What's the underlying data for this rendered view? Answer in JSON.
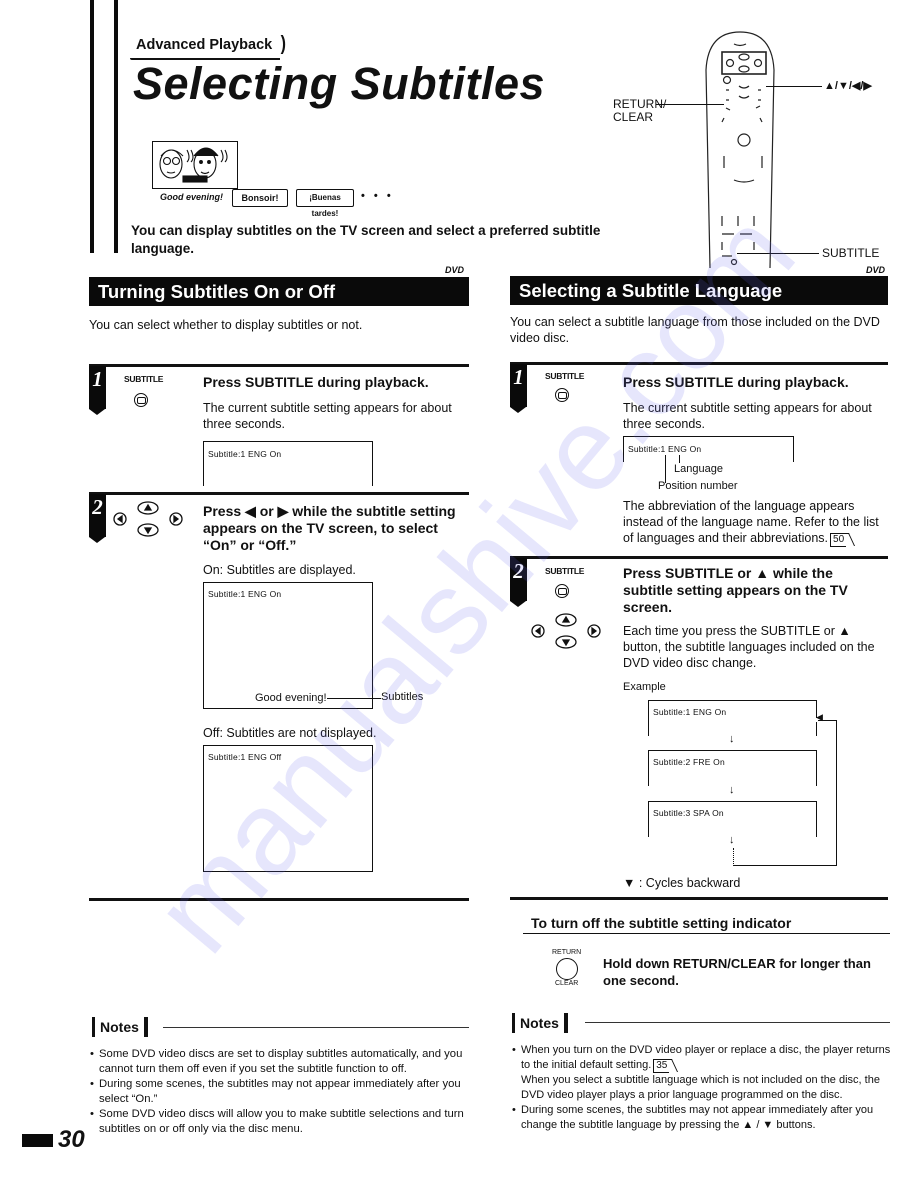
{
  "header": {
    "breadcrumb": "Advanced Playback",
    "title": "Selecting Subtitles",
    "intro": "You can display subtitles on the TV screen and select a preferred subtitle language."
  },
  "illustration": {
    "bubbles": [
      "Good evening!",
      "Bonsoir!",
      "¡Buenas tardes!"
    ],
    "ellipsis": "• • •"
  },
  "remote": {
    "labels": {
      "arrows": "▲/▼/◀/▶",
      "return_clear": "RETURN/\nCLEAR",
      "return_line1": "RETURN/",
      "return_line2": "CLEAR",
      "subtitle": "SUBTITLE"
    }
  },
  "left_section": {
    "badge": "DVD",
    "title": "Turning Subtitles On or Off",
    "intro": "You can select whether to display subtitles or not.",
    "steps": [
      {
        "number": "1",
        "button_label": "SUBTITLE",
        "heading": "Press SUBTITLE during playback.",
        "body": "The current subtitle setting appears for about three seconds.",
        "screen_text": "Subtitle:1  ENG  On"
      },
      {
        "number": "2",
        "heading": "Press ◀ or ▶ while the subtitle setting appears on the TV screen, to select “On” or “Off.”",
        "on_caption": "On: Subtitles are displayed.",
        "on_screen_text": "Subtitle:1  ENG  On",
        "on_subtitle_sample": "Good evening!",
        "on_callout": "Subtitles",
        "off_caption": "Off: Subtitles are not displayed.",
        "off_screen_text": "Subtitle:1  ENG  Off"
      }
    ],
    "notes": {
      "label": "Notes",
      "items": [
        "Some DVD video discs are set to display subtitles automatically, and you cannot turn them off even if you set the subtitle function to off.",
        "During some scenes, the subtitles may not appear immediately after you select “On.”",
        "Some DVD video discs will allow you to make subtitle selections and turn subtitles on or off only via the disc menu."
      ]
    }
  },
  "right_section": {
    "badge": "DVD",
    "title": "Selecting a Subtitle Language",
    "intro": "You can select a subtitle language from those included on the DVD video disc.",
    "steps": [
      {
        "number": "1",
        "button_label": "SUBTITLE",
        "heading": "Press SUBTITLE during playback.",
        "body": "The current subtitle setting appears for about three seconds.",
        "screen_text": "Subtitle:1  ENG  On",
        "callout_language": "Language",
        "callout_position": "Position number",
        "after": "The abbreviation of the language appears instead of the language name. Refer to the list of languages and their abbreviations.",
        "page_ref": "50"
      },
      {
        "number": "2",
        "button_label": "SUBTITLE",
        "heading": "Press SUBTITLE or ▲ while the subtitle setting appears on the TV screen.",
        "body": "Each time you press the SUBTITLE or ▲ button, the subtitle languages included on the DVD video disc change.",
        "example_label": "Example",
        "example_screens": [
          "Subtitle:1  ENG  On",
          "Subtitle:2  FRE  On",
          "Subtitle:3  SPA  On"
        ],
        "cycle_note": "▼ : Cycles backward"
      }
    ],
    "indicator": {
      "heading": "To turn off the subtitle setting indicator",
      "button_top": "RETURN",
      "button_bottom": "CLEAR",
      "instruction": "Hold down RETURN/CLEAR for longer than one second."
    },
    "notes": {
      "label": "Notes",
      "items": [
        {
          "text": "When you turn on the DVD video player or replace a disc, the player returns to the initial default setting.",
          "page_ref": "35",
          "extra": "When you select a subtitle language which is not included on the disc, the DVD video player plays a prior language programmed on the disc."
        },
        {
          "text": "During some scenes, the subtitles may not appear immediately after you change the subtitle language by pressing the ▲ / ▼ buttons."
        }
      ]
    }
  },
  "footer": {
    "page_number": "30"
  },
  "watermark": "manualshive.com"
}
